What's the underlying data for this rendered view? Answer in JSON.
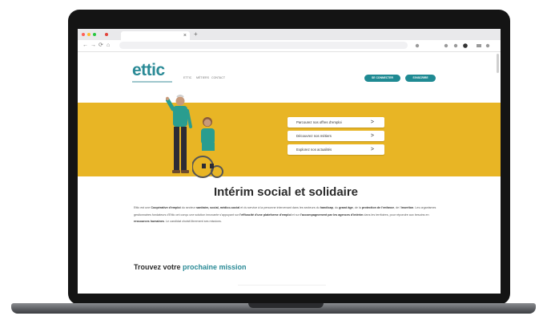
{
  "browser": {
    "traffic_lights": [
      "#ff5f57",
      "#febc2e",
      "#28c840"
    ],
    "tab_close": "×",
    "new_tab": "+",
    "toolbar_icons": [
      "←",
      "→",
      "⟳",
      "⌂"
    ]
  },
  "site": {
    "logo_text": "ettic",
    "accent_color": "#2a8a96",
    "hero_color": "#e8b525",
    "nav": [
      "ETTIC",
      "MÉTIERS",
      "CONTACT"
    ],
    "login_button": "SE CONNECTER",
    "register_button": "S'INSCRIRE",
    "cta_buttons": [
      {
        "label": "Parcourez nos offres d'emploi",
        "arrow": ">"
      },
      {
        "label": "Découvrez nos métiers",
        "arrow": ">"
      },
      {
        "label": "Explorez nos actualités",
        "arrow": ">"
      }
    ],
    "heading": "Intérim social et solidaire",
    "intro": {
      "p1": "Ettic est une ",
      "b1": "Coopérative d'emploi",
      "p2": " du secteur ",
      "b2": "sanitaire, social, médico-social",
      "p3": " et du service à la personne intervenant dans les secteurs du ",
      "b3": "handicap",
      "p4": ", du ",
      "b4": "grand âge",
      "p5": ", de la ",
      "b5": "protection de l'enfance",
      "p6": ", de l'",
      "b6": "insertion",
      "p7": ". Les organismes gestionnaires fondateurs d'Ettic ont conçu une solution innovante s'appuyant sur ",
      "b7": "l'efficacité d'une plateforme d'emploi",
      "p8": " et sur ",
      "b8": "l'accompagnement par les agences d'intérim",
      "p9": " dans les territoires, pour répondre aux besoins en ",
      "b9": "ressources humaines",
      "p10": ". Le candidat choisit librement ses missions."
    },
    "subheading_prefix": "Trouvez votre ",
    "subheading_accent": "prochaine mission"
  }
}
